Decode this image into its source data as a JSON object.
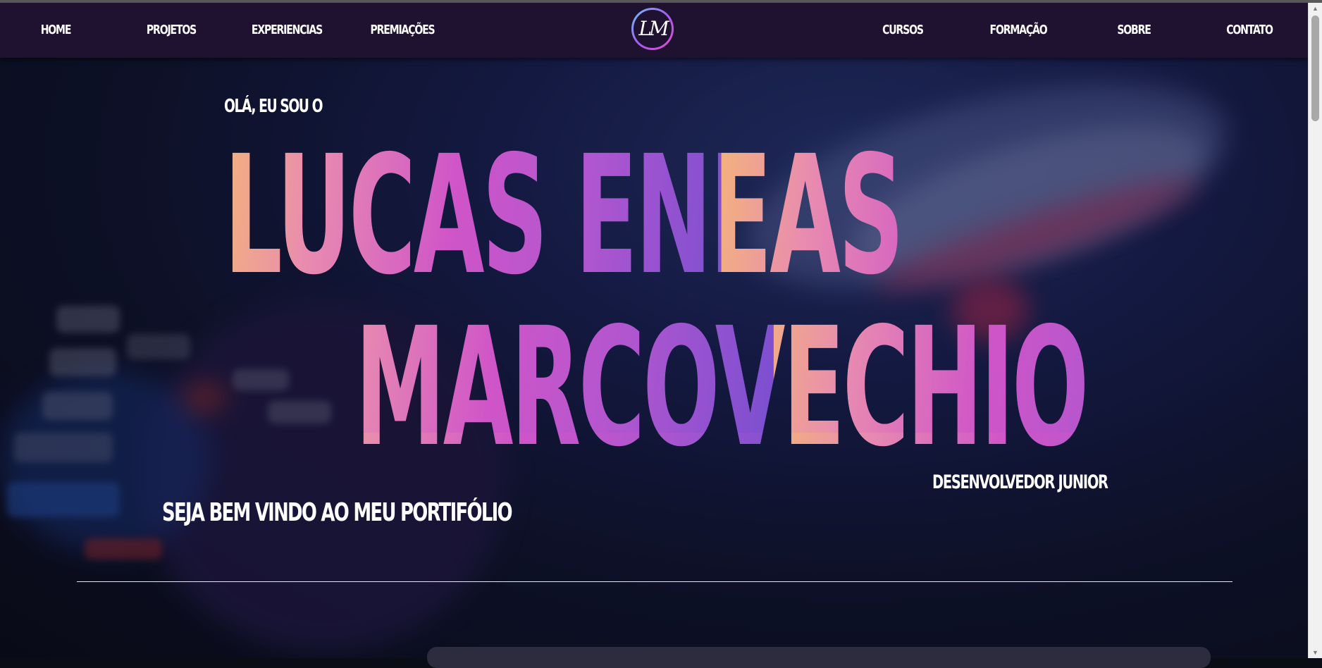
{
  "nav": {
    "left_items": [
      {
        "label": "HOME"
      },
      {
        "label": "PROJETOS"
      },
      {
        "label": "EXPERIENCIAS"
      },
      {
        "label": "PREMIAÇÕES"
      }
    ],
    "logo_text": "LM",
    "right_items": [
      {
        "label": "CURSOS"
      },
      {
        "label": "FORMAÇÃO"
      },
      {
        "label": "SOBRE"
      },
      {
        "label": "CONTATO"
      }
    ]
  },
  "hero": {
    "greeting": "OLÁ, EU SOU O",
    "name_line_1": "LUCAS ENEAS",
    "name_line_2": "MARCOVECHIO",
    "role": "DESENVOLVEDOR JUNIOR",
    "welcome": "SEJA BEM VINDO AO MEU PORTIFÓLIO"
  },
  "colors": {
    "navbar_bg": "#1f1230",
    "name_gradient_start": "#f3b27e",
    "name_gradient_mid": "#cf55c8",
    "name_gradient_end": "#7a4fd0",
    "text": "#ffffff"
  },
  "icons": {
    "scroll_up": "triangle-up-icon",
    "scroll_down": "triangle-down-icon"
  }
}
